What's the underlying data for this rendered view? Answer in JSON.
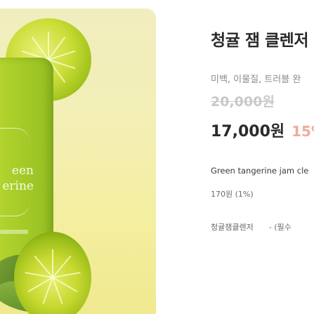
{
  "product": {
    "title": "청귤 잼 클렌저",
    "subtitle": "미백, 이물질, 트러블 완",
    "original_price": "20,000원",
    "sale_price": "17,000원",
    "discount": "15%",
    "english_name": "Green tangerine jam cle",
    "points": "170원 (1%)",
    "option_name": "청귤잼클렌저",
    "option_suffix": "- (필수"
  },
  "image": {
    "tube_text_line1": "een",
    "tube_text_line2": "erine"
  }
}
